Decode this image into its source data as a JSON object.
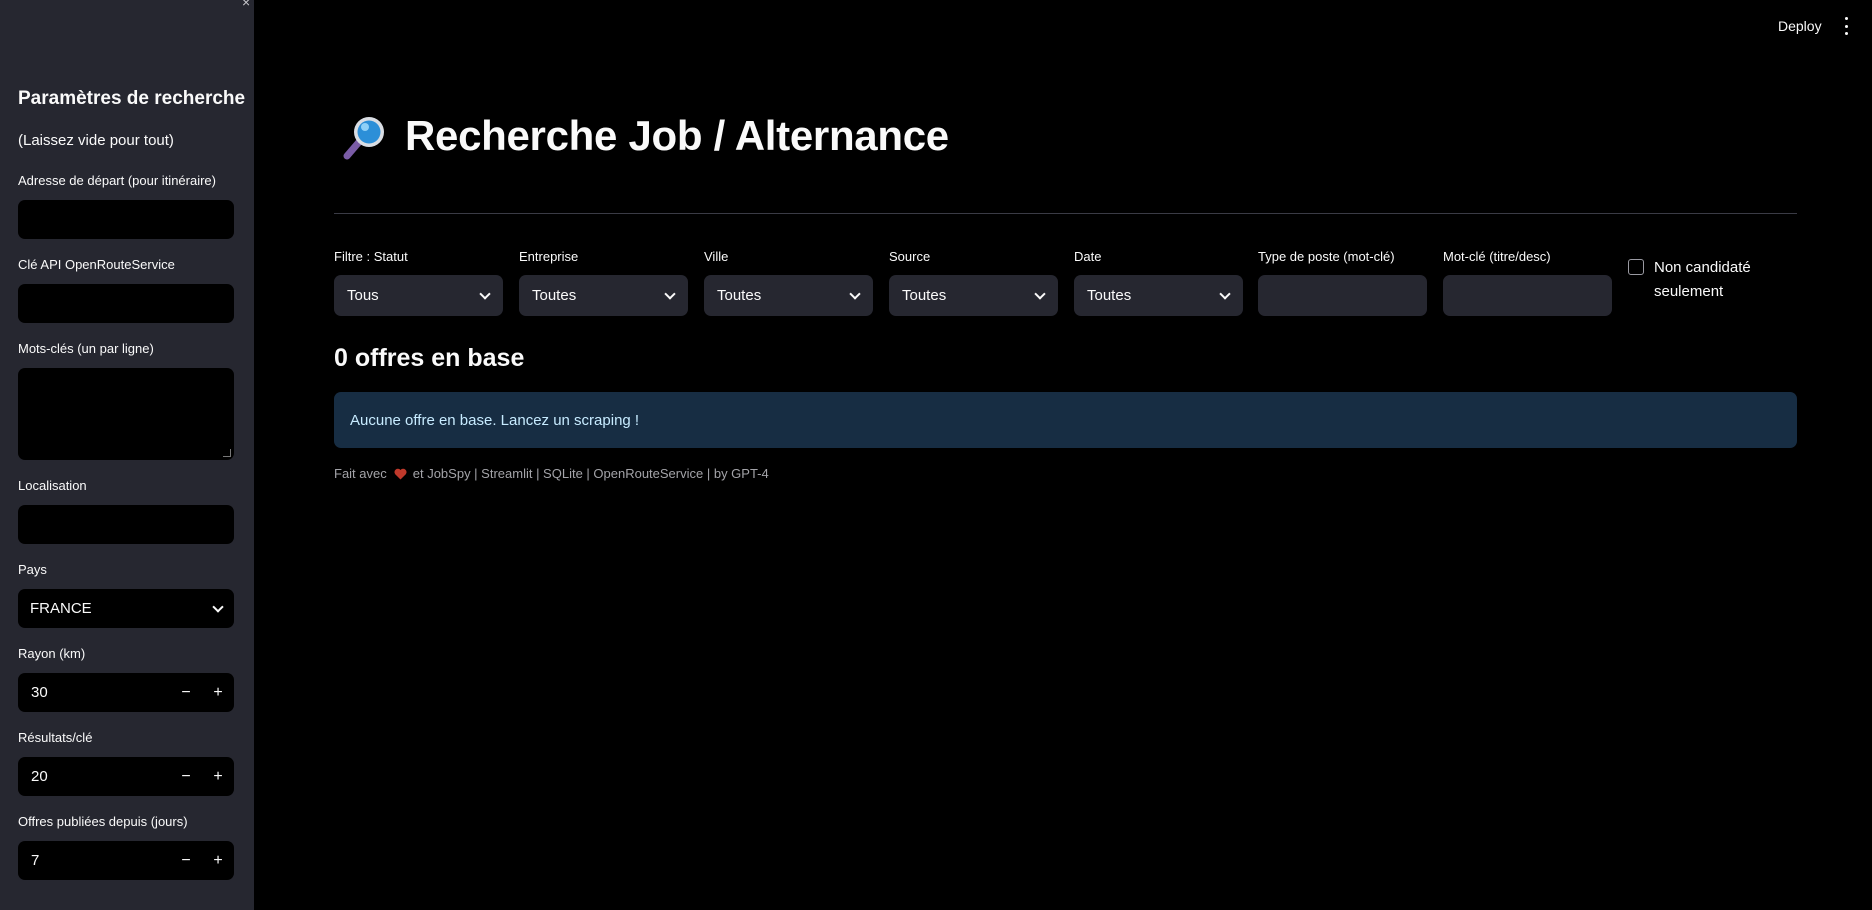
{
  "sidebar": {
    "close_icon": "×",
    "title": "Paramètres de recherche",
    "subtitle": "(Laissez vide pour tout)",
    "fields": {
      "address_label": "Adresse de départ (pour itinéraire)",
      "address_value": "",
      "api_label": "Clé API OpenRouteService",
      "api_value": "",
      "keywords_label": "Mots-clés (un par ligne)",
      "location_label": "Localisation",
      "location_value": "",
      "country_label": "Pays",
      "country_value": "FRANCE",
      "radius_label": "Rayon (km)",
      "radius_value": "30",
      "results_label": "Résultats/clé",
      "results_value": "20",
      "days_label": "Offres publiées depuis (jours)",
      "days_value": "7",
      "minus": "−",
      "plus": "+"
    }
  },
  "header": {
    "deploy_label": "Deploy",
    "menu_icon": "more-vertical-icon"
  },
  "main": {
    "title": "Recherche Job / Alternance",
    "title_icon": "magnifier-icon",
    "filters": [
      {
        "label": "Filtre : Statut",
        "value": "Tous"
      },
      {
        "label": "Entreprise",
        "value": "Toutes"
      },
      {
        "label": "Ville",
        "value": "Toutes"
      },
      {
        "label": "Source",
        "value": "Toutes"
      },
      {
        "label": "Date",
        "value": "Toutes"
      },
      {
        "label": "Type de poste (mot-clé)",
        "value": ""
      },
      {
        "label": "Mot-clé (titre/desc)",
        "value": ""
      }
    ],
    "checkbox_label": "Non candidaté seulement",
    "count_text": "0 offres en base",
    "info_text": "Aucune offre en base. Lancez un scraping !",
    "footer_before": "Fait avec",
    "footer_after": "et JobSpy | Streamlit | SQLite | OpenRouteService | by GPT-4"
  },
  "colors": {
    "background": "#000000",
    "sidebar": "#262730",
    "info_bg": "#172d43",
    "info_text": "#c7ebff",
    "heart": "#c0392b"
  }
}
